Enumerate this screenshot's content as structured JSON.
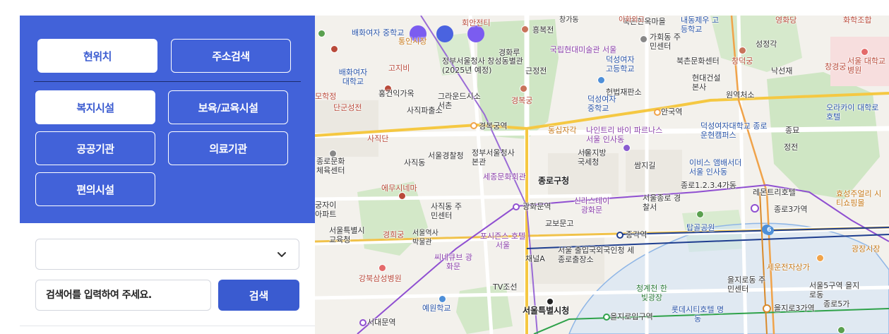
{
  "panel": {
    "location_tabs": {
      "current_location": "현위치",
      "address_search": "주소검색"
    },
    "categories": [
      "복지시설",
      "보육/교육시설",
      "공공기관",
      "의료기관",
      "편의시설"
    ]
  },
  "search": {
    "select_value": "",
    "placeholder": "검색어를 입력하여 주세요.",
    "button": "검색"
  },
  "colors": {
    "accent": "#4262d9",
    "button_blue": "#3a5bd0",
    "marker_purple": "#7b5cf0",
    "marker_blue": "#4a63e0"
  },
  "map": {
    "labels": {
      "l1": "배화여자 중학교",
      "l2": "통인시장",
      "l3": "회안전티",
      "l4": "흥복전",
      "l5": "북촌한옥마을",
      "l6": "내동제우 고등학교",
      "l7": "경화루",
      "l8": "국립현대미술관 서울",
      "l9": "가회동 주민센터",
      "l10": "성정각",
      "l11": "배화여자 대학교",
      "l12": "고지비",
      "l13": "정부서울청사 창성동별관 (2025년 예정)",
      "l14": "근정전",
      "l15": "덕성여자 고등학교",
      "l16": "북촌문화센터",
      "l17": "창덕궁",
      "l18": "낙선재",
      "l19": "창경궁",
      "l20": "홍건익가옥",
      "l21": "그라운드시소 서촌",
      "l22": "경복궁",
      "l23": "헌법재판소",
      "l24": "현대건설 본사",
      "l25": "원역처소",
      "l26": "단군성전",
      "l27": "사직파출소",
      "l28": "덕성여자 중학교",
      "l29": "안국역",
      "l30": "경복궁역",
      "l31": "동십자각",
      "l32": "나인트리 바이 파르나스 서울 인사동",
      "l33": "덕성여자대학교 종로운현캠퍼스",
      "l34": "종묘",
      "l35": "정전",
      "l36": "사직단",
      "l37": "서울경찰청",
      "l38": "정부서울청사 본관",
      "l39": "서울지방 국세청",
      "l40": "쌈지길",
      "l41": "이비스 앰배서더 서울 인사동",
      "l42": "종로문화 체육센터",
      "l43": "사직동",
      "l44": "세종문화회관",
      "l45": "종로구청",
      "l46": "종로1.2.3.4가동",
      "l47": "레몬트리호텔",
      "l48": "에무시네마",
      "l49": "신라스테이 광화문",
      "l50": "서울종로 경찰서",
      "l51": "종로3가역",
      "l52": "사직동 주민센터",
      "l53": "광화문역",
      "l54": "교보문고",
      "l55": "서울특별시 교육청",
      "l56": "경희궁",
      "l57": "서울역사 박물관",
      "l58": "포시즌스 호텔 서울",
      "l59": "종각역",
      "l60": "탑골공원",
      "l61": "씨네큐브 광화문",
      "l62": "채널A",
      "l63": "서울 출입국외국인청 세종로출장소",
      "l64": "강북삼성병원",
      "l65": "세운전자상가",
      "l66": "청계천 한빛광장",
      "l67": "을지로동 주민센터",
      "l68": "TV조선",
      "l69": "예원학교",
      "l70": "서울특별시청",
      "l71": "을지로입구역",
      "l72": "롯데시티호텔 명동",
      "l73": "을지로3가역",
      "l74": "서대문역",
      "l75": "오라카이 대학로호텔",
      "l76": "서울 대학교병원",
      "l77": "효성주얼리 시티쇼핑몰",
      "l78": "광장시장",
      "l79": "종로5가",
      "l80": "서울5구역 을지로동",
      "l81": "궁자이 아파트",
      "l82": "6",
      "l83": "영화당",
      "l84": "화학조합",
      "l85": "이화외고",
      "l86": "모학정",
      "l87": "창가동"
    }
  }
}
